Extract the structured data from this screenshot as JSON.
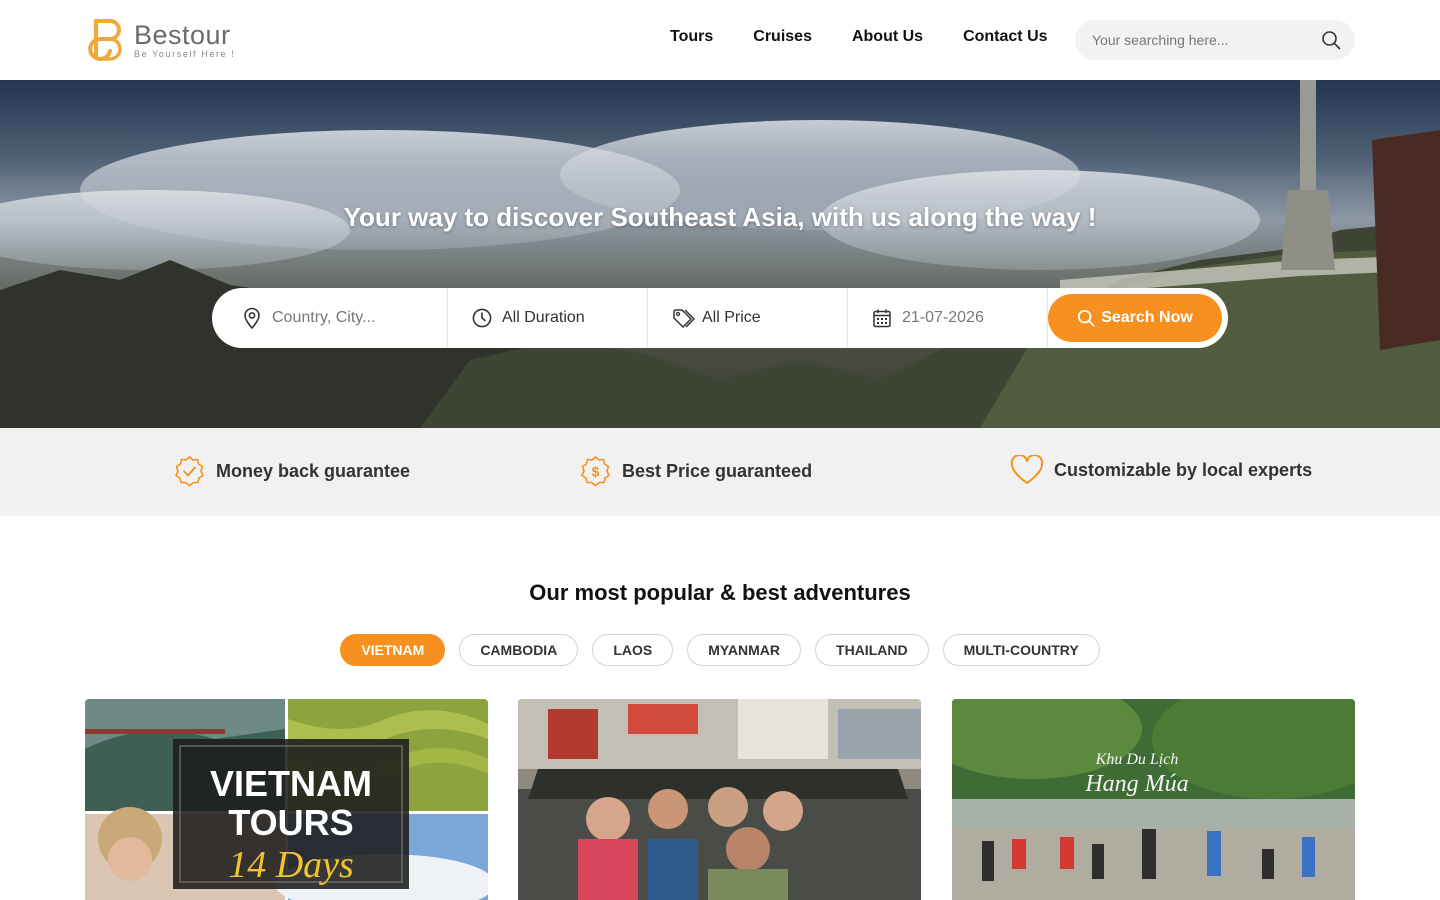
{
  "brand": {
    "name": "Bestour",
    "tagline": "Be Yourself Here !"
  },
  "nav": [
    {
      "label": "Tours"
    },
    {
      "label": "Cruises"
    },
    {
      "label": "About Us"
    },
    {
      "label": "Contact Us"
    }
  ],
  "header_search": {
    "placeholder": "Your searching here..."
  },
  "hero": {
    "title": "Your way to discover Southeast Asia, with us along the way !",
    "search": {
      "location_placeholder": "Country, City...",
      "duration": "All Duration",
      "price": "All Price",
      "date_placeholder": "21-07-2026",
      "button": "Search Now"
    }
  },
  "guarantees": [
    {
      "label": "Money back guarantee",
      "icon": "badge-check-icon"
    },
    {
      "label": "Best Price guaranteed",
      "icon": "dollar-badge-icon"
    },
    {
      "label": "Customizable by local experts",
      "icon": "heart-icon"
    }
  ],
  "popular": {
    "title": "Our most popular & best adventures",
    "tabs": [
      "VIETNAM",
      "CAMBODIA",
      "LAOS",
      "MYANMAR",
      "THAILAND",
      "MULTI-COUNTRY"
    ],
    "active_tab": "VIETNAM",
    "cards": [
      {
        "overlay_line1": "VIETNAM",
        "overlay_line2": "TOURS",
        "overlay_line3": "14 Days"
      },
      {
        "image": "group-in-jeep-photo"
      },
      {
        "sign_line1": "Khu Du Lịch",
        "sign_line2": "Hang Múa"
      }
    ]
  },
  "colors": {
    "accent": "#f7901e",
    "logo": "#f0a93a",
    "guarantee_band": "#f1f1f1"
  }
}
